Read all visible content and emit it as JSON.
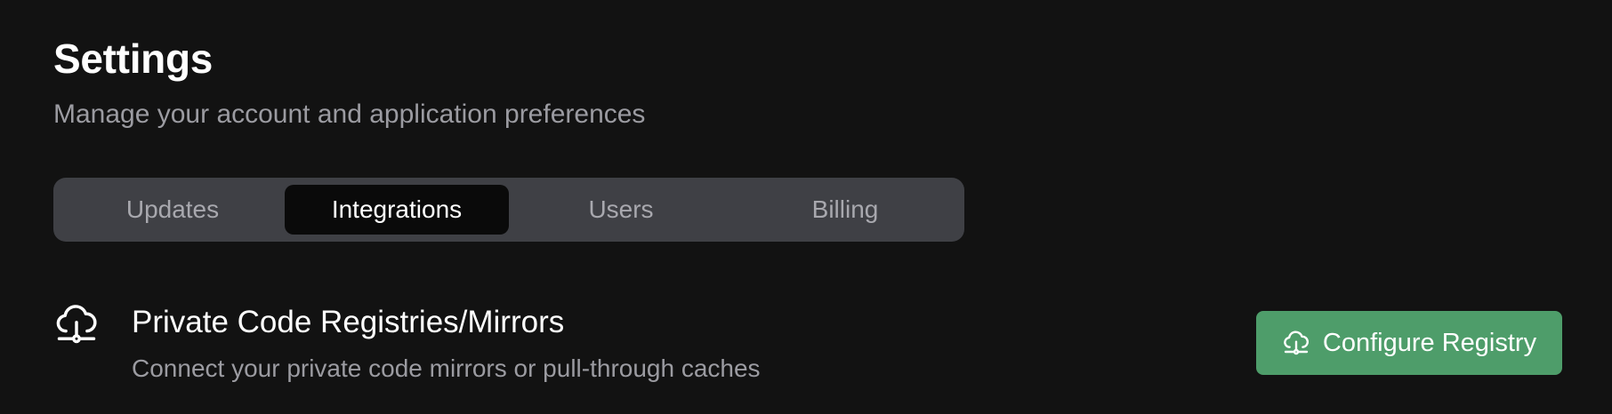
{
  "header": {
    "title": "Settings",
    "subtitle": "Manage your account and application preferences"
  },
  "tabs": [
    {
      "label": "Updates",
      "active": false
    },
    {
      "label": "Integrations",
      "active": true
    },
    {
      "label": "Users",
      "active": false
    },
    {
      "label": "Billing",
      "active": false
    }
  ],
  "section": {
    "icon": "cloud-network-icon",
    "title": "Private Code Registries/Mirrors",
    "description": "Connect your private code mirrors or pull-through caches",
    "button": {
      "label": "Configure Registry",
      "icon": "cloud-network-icon"
    }
  },
  "colors": {
    "background": "#121212",
    "tab_bar": "#3f4045",
    "active_tab": "#0a0a0a",
    "accent_button": "#4e9d6a"
  }
}
